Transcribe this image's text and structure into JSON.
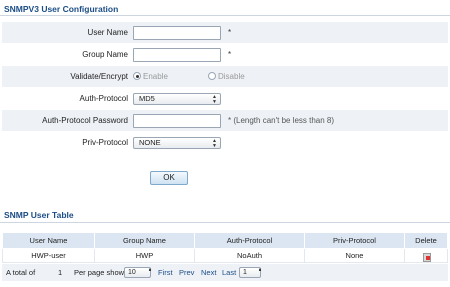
{
  "config": {
    "title": "SNMPV3 User Configuration",
    "fields": {
      "user_name": {
        "label": "User Name",
        "value": "",
        "required": "*"
      },
      "group_name": {
        "label": "Group Name",
        "value": "",
        "required": "*"
      },
      "validate_encrypt": {
        "label": "Validate/Encrypt",
        "options": [
          "Enable",
          "Disable"
        ],
        "selected": "Enable"
      },
      "auth_protocol": {
        "label": "Auth-Protocol",
        "value": "MD5"
      },
      "auth_password": {
        "label": "Auth-Protocol Password",
        "value": "",
        "hint": "* (Length can't be less than 8)"
      },
      "priv_protocol": {
        "label": "Priv-Protocol",
        "value": "NONE"
      }
    },
    "ok_label": "OK"
  },
  "table": {
    "title": "SNMP User Table",
    "columns": [
      "User Name",
      "Group Name",
      "Auth-Protocol",
      "Priv-Protocol",
      "Delete"
    ],
    "rows": [
      {
        "user_name": "HWP-user",
        "group_name": "HWP",
        "auth": "NoAuth",
        "priv": "None"
      }
    ]
  },
  "pager": {
    "total_label": "A total of",
    "total": "1",
    "per_page_label": "Per page show",
    "per_page": "10",
    "first": "First",
    "prev": "Prev",
    "next": "Next",
    "last": "Last",
    "page": "1"
  },
  "colors": {
    "title": "#1b4d86",
    "row_alt": "#eef2f7",
    "header_bg": "#dbe6f2"
  }
}
